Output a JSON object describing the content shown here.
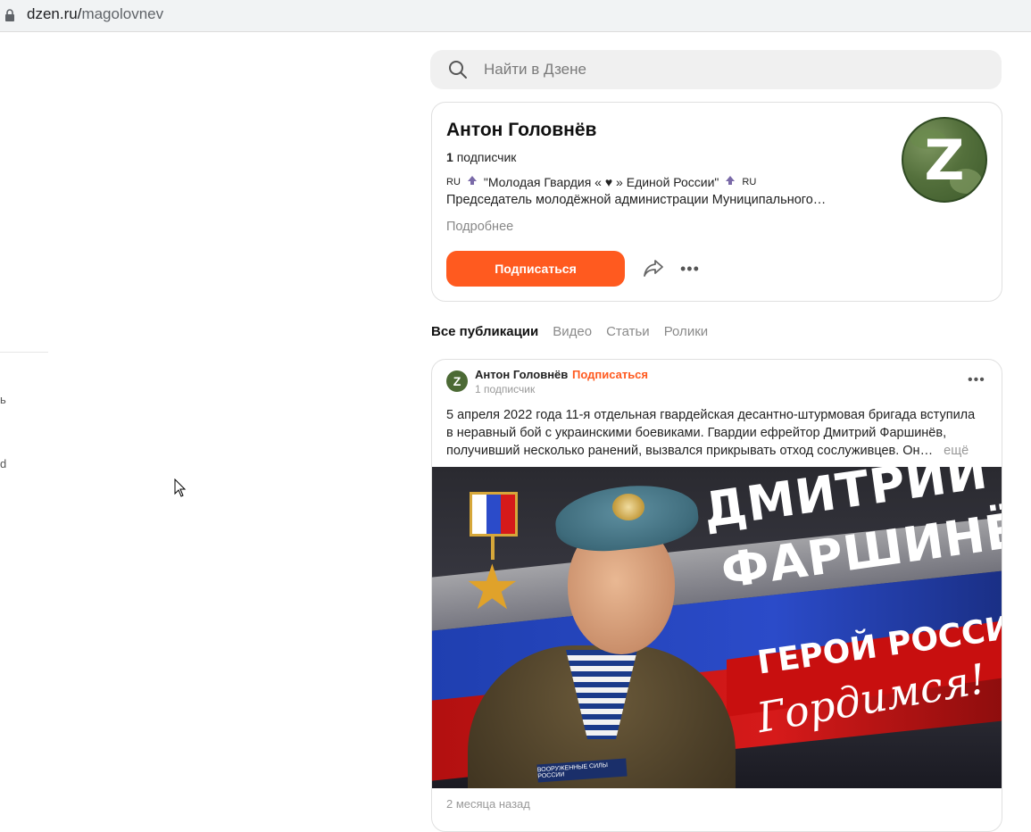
{
  "browser": {
    "url_host": "dzen.ru/",
    "url_path": "magolovnev"
  },
  "left_fragments": [
    "ь",
    "d"
  ],
  "search": {
    "placeholder": "Найти в Дзене"
  },
  "channel": {
    "name": "Антон Головнёв",
    "subscribers_count": "1",
    "subscribers_label": "подписчик",
    "description_line1": {
      "prefix": "RU",
      "text": "\"Молодая Гвардия « ♥ » Единой России\"",
      "suffix": "RU"
    },
    "description_line2": "Председатель молодёжной администрации Муниципального…",
    "more_label": "Подробнее",
    "subscribe_button": "Подписаться",
    "avatar_letter": "Z"
  },
  "tabs": [
    {
      "label": "Все публикации",
      "active": true
    },
    {
      "label": "Видео",
      "active": false
    },
    {
      "label": "Статьи",
      "active": false
    },
    {
      "label": "Ролики",
      "active": false
    }
  ],
  "post": {
    "author": "Антон Головнёв",
    "separator": "·",
    "subscribe_link": "Подписаться",
    "author_subscribers": "1 подписчик",
    "avatar_letter": "Z",
    "text_line1": "5 апреля 2022 года 11-я отдельная гвардейская десантно-штурмовая бригада вступила",
    "text_line2": "в неравный бой с украинскими боевиками. Гвардии ефрейтор Дмитрий Фаршинёв,",
    "text_line3": "получивший несколько ранений, вызвался прикрывать отход сослуживцев. Он…",
    "more_label": "ещё",
    "image": {
      "title_line1": "ДМИТРИЙ",
      "title_line2": "ФАРШИНЁВ",
      "banner_text": "ГЕРОЙ РОССИИ",
      "script_text": "Гордимся!",
      "patch_text": "ВООРУЖЕННЫЕ СИЛЫ РОССИИ"
    },
    "date": "2 месяца назад"
  },
  "colors": {
    "accent": "#ff5a1f",
    "card_border": "#e0e0e0",
    "muted_text": "#888888"
  }
}
